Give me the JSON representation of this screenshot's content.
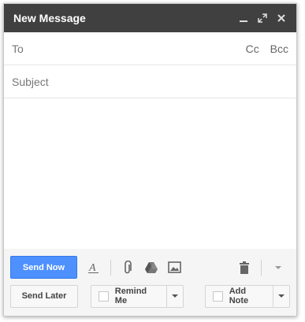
{
  "window": {
    "title": "New Message"
  },
  "compose": {
    "to_label": "To",
    "cc_label": "Cc",
    "bcc_label": "Bcc",
    "subject_label": "Subject"
  },
  "toolbar": {
    "send_now": "Send Now",
    "send_later": "Send Later",
    "remind_me": "Remind Me",
    "add_note": "Add Note"
  },
  "colors": {
    "titlebar": "#404040",
    "send_button": "#4d90fe"
  },
  "icons": [
    "minimize-icon",
    "expand-icon",
    "close-icon",
    "text-format-icon",
    "attach-icon",
    "drive-icon",
    "photo-icon",
    "trash-icon",
    "more-options-icon"
  ]
}
